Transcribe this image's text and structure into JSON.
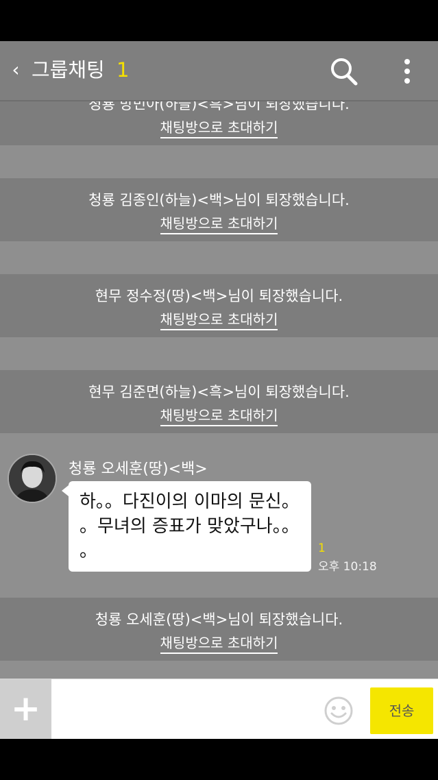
{
  "header": {
    "back_label": "‹",
    "title": "그룹채팅",
    "member_count": "1"
  },
  "notices": [
    {
      "text": "청룡 방민아(하늘)<흑>님이 퇴장했습니다.",
      "invite": "채팅방으로 초대하기"
    },
    {
      "text": "청룡 김종인(하늘)<백>님이 퇴장했습니다.",
      "invite": "채팅방으로 초대하기"
    },
    {
      "text": "현무 정수정(땅)<백>님이 퇴장했습니다.",
      "invite": "채팅방으로 초대하기"
    },
    {
      "text": "현무 김준면(하늘)<흑>님이 퇴장했습니다.",
      "invite": "채팅방으로 초대하기"
    },
    {
      "text": "청룡 오세훈(땅)<백>님이 퇴장했습니다.",
      "invite": "채팅방으로 초대하기"
    }
  ],
  "message": {
    "sender": "청룡 오세훈(땅)<백>",
    "text": "하。。다진이의 이마의 문신。\n。무녀의 증표가 맞았구나。。\n。",
    "read_count": "1",
    "time": "오후 10:18"
  },
  "composer": {
    "send_label": "전송"
  }
}
